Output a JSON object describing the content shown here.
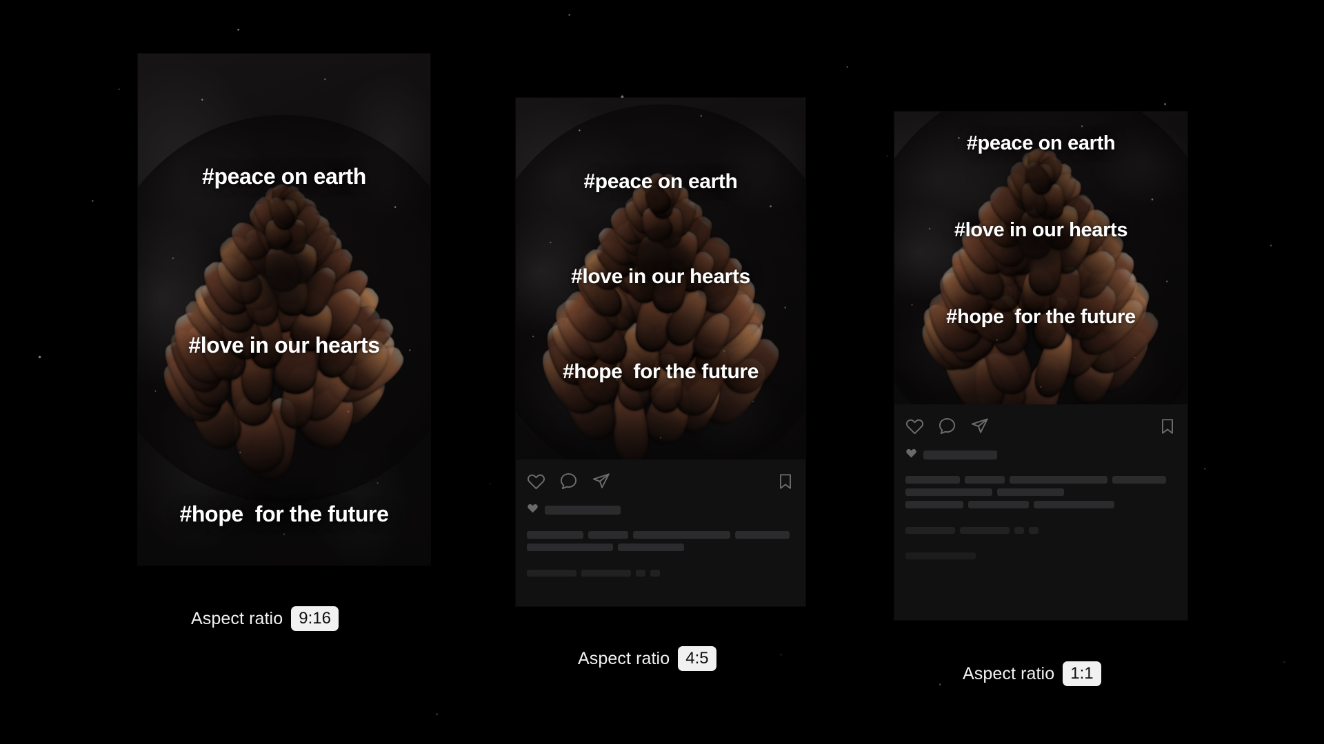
{
  "scene": {
    "background_color": "#000000",
    "accent_text_color": "#ffffff",
    "pill_background": "#f1f1f1",
    "pill_text_color": "#101010"
  },
  "overlay_text": {
    "line1": "#peace on earth",
    "line2": "#love in our hearts",
    "line3": "#hope  for the future"
  },
  "cards": [
    {
      "id": "story-9-16",
      "ratio_caption": "Aspect ratio",
      "ratio_value": "9:16",
      "has_instagram_chrome": false,
      "tags": {
        "line1": "#peace on earth",
        "line2": "#love in our hearts",
        "line3": "#hope  for the future"
      }
    },
    {
      "id": "portrait-4-5",
      "ratio_caption": "Aspect ratio",
      "ratio_value": "4:5",
      "has_instagram_chrome": true,
      "tags": {
        "line1": "#peace on earth",
        "line2": "#love in our hearts",
        "line3": "#hope  for the future"
      }
    },
    {
      "id": "square-1-1",
      "ratio_caption": "Aspect ratio",
      "ratio_value": "1:1",
      "has_instagram_chrome": true,
      "tags": {
        "line1": "#peace on earth",
        "line2": "#love in our hearts",
        "line3": "#hope  for the future"
      }
    }
  ],
  "instagram_chrome": {
    "icons": [
      "heart-icon",
      "comment-icon",
      "share-icon",
      "bookmark-icon"
    ],
    "likes_icon": "heart-solid-icon"
  }
}
